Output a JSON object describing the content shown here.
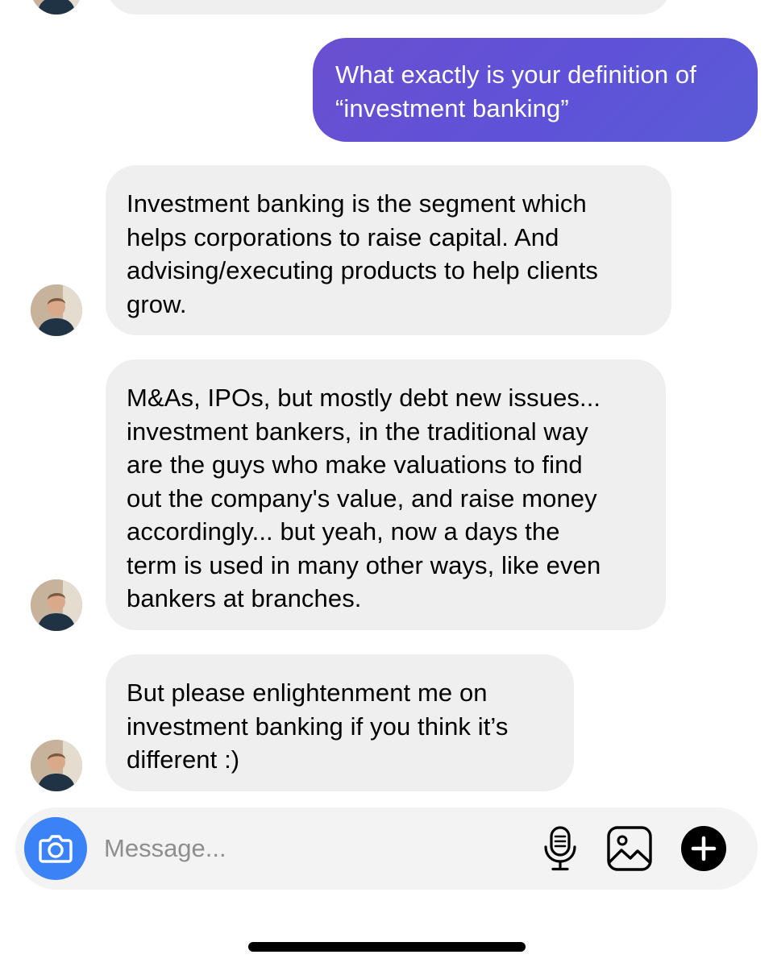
{
  "thread": {
    "messages": [
      {
        "sender": "me",
        "text": "What exactly is your definition of\n“investment banking”"
      },
      {
        "sender": "them",
        "text": "Investment banking is the segment which\nhelps corporations to raise capital. And\nadvising/executing products to help clients\ngrow."
      },
      {
        "sender": "them",
        "text": "M&As, IPOs, but mostly debt new issues...\ninvestment bankers, in the traditional way\nare the guys who make valuations to find\nout the company's value, and raise money\naccordingly... but yeah, now a days the\nterm is used in many other ways, like even\nbankers at branches."
      },
      {
        "sender": "them",
        "text": "But please enlightenment me on\ninvestment banking if you think it’s\ndifferent :)"
      }
    ]
  },
  "composer": {
    "placeholder": "Message...",
    "icons": {
      "camera": "camera-icon",
      "mic": "microphone-icon",
      "gallery": "image-icon",
      "add": "plus-icon"
    }
  },
  "colors": {
    "outgoing_bubble": "#6150d4",
    "incoming_bubble": "#efefef",
    "camera_button": "#3b82f6",
    "composer_bg": "#f3f3f3"
  }
}
